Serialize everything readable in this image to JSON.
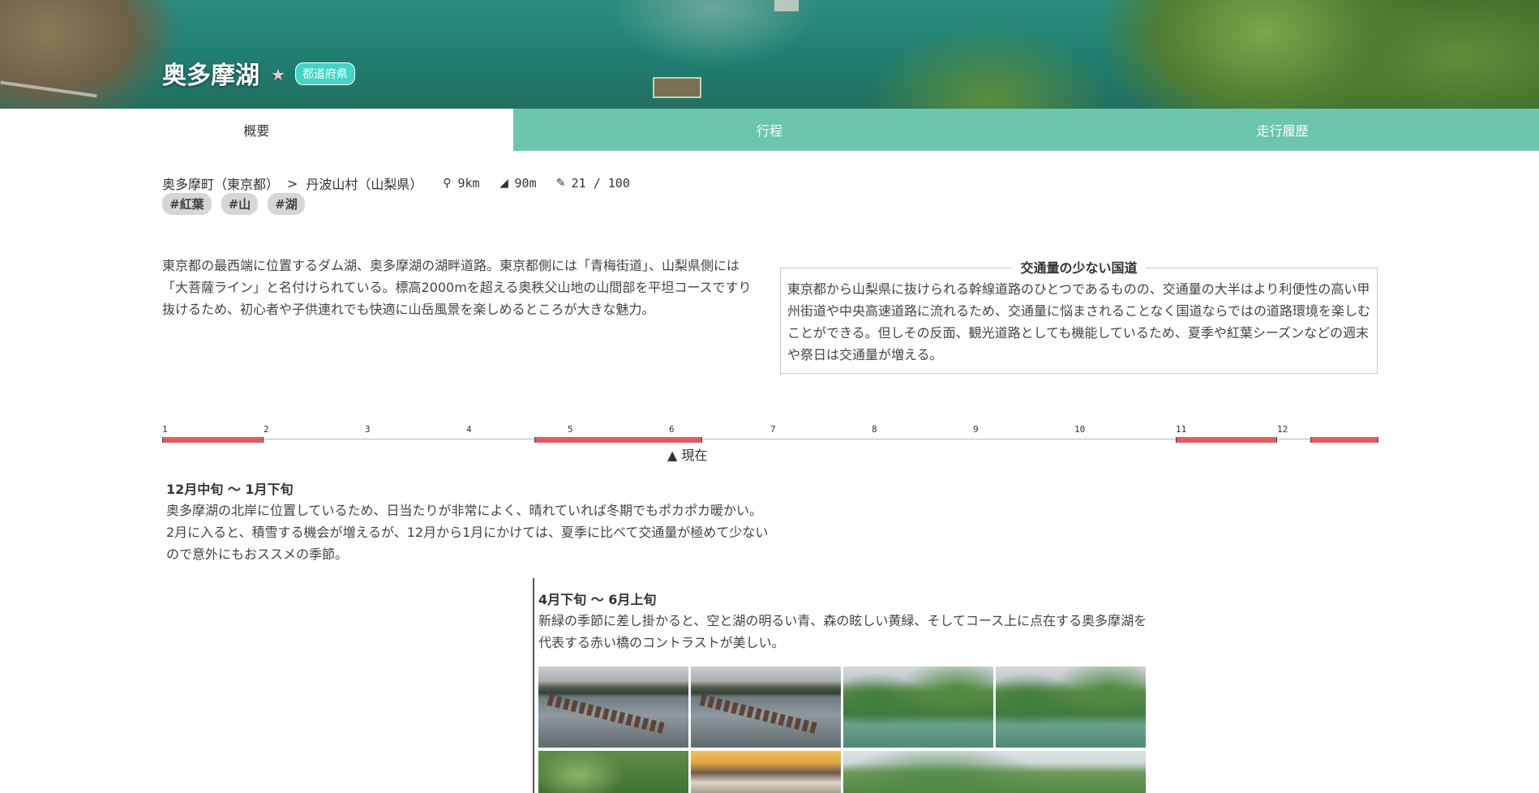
{
  "hero": {
    "title": "奥多摩湖",
    "star": "★",
    "badge": "都道府県"
  },
  "tabs": [
    {
      "label": "概要",
      "active": true
    },
    {
      "label": "行程",
      "active": false
    },
    {
      "label": "走行履歴",
      "active": false
    }
  ],
  "meta": {
    "start": "奥多摩町（東京都）",
    "separator": ">",
    "end": "丹波山村（山梨県）",
    "distance": "9km",
    "elevation": "90m",
    "rating": "21 / 100",
    "icons": [
      "route-icon",
      "elevation-icon",
      "pin-icon"
    ]
  },
  "tags": [
    "#紅葉",
    "#山",
    "#湖"
  ],
  "description": "東京都の最西端に位置するダム湖、奥多摩湖の湖畔道路。東京都側には「青梅街道」、山梨県側には「大菩薩ライン」と名付けられている。標高2000mを超える奥秩父山地の山間部を平坦コースですり抜けるため、初心者や子供連れでも快適に山岳風景を楽しめるところが大きな魅力。",
  "note": {
    "title": "交通量の少ない国道",
    "body": "東京都から山梨県に抜けられる幹線道路のひとつであるものの、交通量の大半はより利便性の高い甲州街道や中央高速道路に流れるため、交通量に悩まされることなく国道ならではの道路環境を楽しむことができる。但しその反面、観光道路としても機能しているため、夏季や紅葉シーズンなどの週末や祭日は交通量が増える。"
  },
  "timeline": {
    "months": [
      "1",
      "2",
      "3",
      "4",
      "5",
      "6",
      "7",
      "8",
      "9",
      "10",
      "11",
      "12"
    ],
    "now_label": "▲ 現在",
    "bar_color": "#e8595d",
    "highlighted_months": [
      {
        "from_month": 1.0,
        "to_month": 2.0
      },
      {
        "from_month": 4.67,
        "to_month": 6.33
      },
      {
        "from_month": 11.0,
        "to_month": 12.0
      },
      {
        "from_month": 12.33,
        "to_month": 13.0
      }
    ]
  },
  "seasons": [
    {
      "period": "12月中旬 ～ 1月下旬",
      "text": "奥多摩湖の北岸に位置しているため、日当たりが非常によく、晴れていれば冬期でもポカポカ暖かい。2月に入ると、積雪する機会が増えるが、12月から1月にかけては、夏季に比べて交通量が極めて少ないので意外にもおススメの季節。"
    },
    {
      "period": "4月下旬 ～ 6月上旬",
      "text": "新緑の季節に差し掛かると、空と湖の明るい青、森の眩しい黄緑、そしてコース上に点在する奥多摩湖を代表する赤い橋のコントラストが美しい。"
    }
  ],
  "colors": {
    "tab_inactive": "#6cc6ab",
    "badge": "#3fd6c6",
    "season_bar": "#e8595d"
  }
}
